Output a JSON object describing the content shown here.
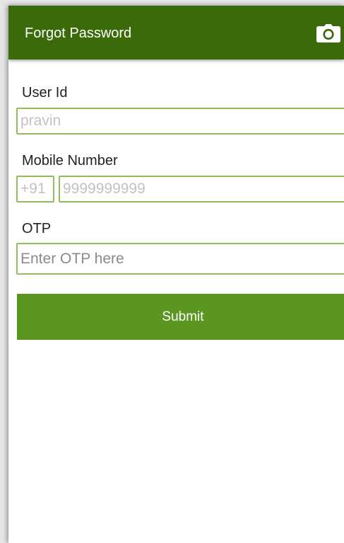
{
  "app_bar": {
    "title": "Forgot Password",
    "icon": "camera-icon",
    "background": "#3b6a0a"
  },
  "form": {
    "user_id": {
      "label": "User Id",
      "placeholder": "pravin"
    },
    "mobile": {
      "label": "Mobile Number",
      "country_code_placeholder": "+91",
      "number_placeholder": "9999999999"
    },
    "otp": {
      "label": "OTP",
      "placeholder": "Enter OTP here"
    },
    "submit_label": "Submit"
  },
  "colors": {
    "accent": "#5a9620",
    "field_border": "#8fbf5c"
  }
}
